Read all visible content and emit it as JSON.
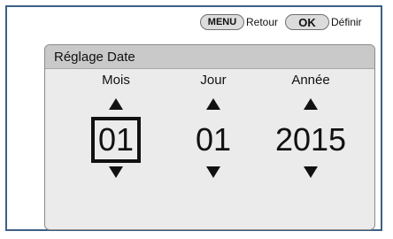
{
  "topbar": {
    "menu_key": "MENU",
    "menu_action": "Retour",
    "ok_key": "OK",
    "ok_action": "Définir"
  },
  "panel": {
    "title": "Réglage Date",
    "columns": [
      {
        "label": "Mois",
        "value": "01",
        "selected": true
      },
      {
        "label": "Jour",
        "value": "01",
        "selected": false
      },
      {
        "label": "Année",
        "value": "2015",
        "selected": false
      }
    ]
  }
}
